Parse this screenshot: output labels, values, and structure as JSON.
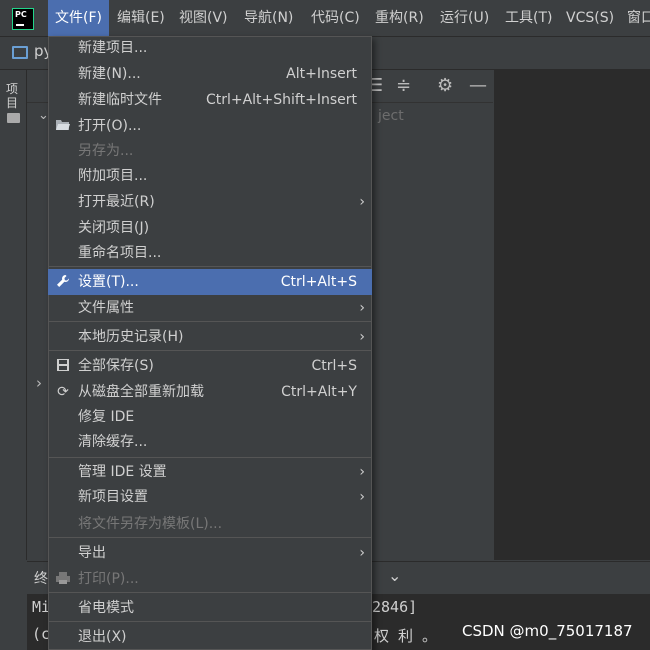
{
  "menubar": {
    "logo_text": "PC",
    "items": [
      "文件(F)",
      "编辑(E)",
      "视图(V)",
      "导航(N)",
      "代码(C)",
      "重构(R)",
      "运行(U)",
      "工具(T)",
      "VCS(S)",
      "窗口"
    ]
  },
  "project": {
    "name": "py",
    "side_tab_label": "项目",
    "hint_text": "ject"
  },
  "terminal": {
    "tab_label": "终",
    "line1_left": "Mi",
    "line1_right": "2846]",
    "line2_left": "(c",
    "line2_right": "权 利 。"
  },
  "watermark": "CSDN @m0_75017187",
  "file_menu": {
    "new_project": "新建项目...",
    "new": "新建(N)...",
    "new_shortcut": "Alt+Insert",
    "new_scratch": "新建临时文件",
    "new_scratch_shortcut": "Ctrl+Alt+Shift+Insert",
    "open": "打开(O)...",
    "save_as": "另存为...",
    "attach_project": "附加项目...",
    "open_recent": "打开最近(R)",
    "close_project": "关闭项目(J)",
    "rename_project": "重命名项目...",
    "settings": "设置(T)...",
    "settings_shortcut": "Ctrl+Alt+S",
    "file_properties": "文件属性",
    "local_history": "本地历史记录(H)",
    "save_all": "全部保存(S)",
    "save_all_shortcut": "Ctrl+S",
    "reload_all": "从磁盘全部重新加载",
    "reload_all_shortcut": "Ctrl+Alt+Y",
    "repair_ide": "修复 IDE",
    "invalidate_caches": "清除缓存...",
    "manage_ide_settings": "管理 IDE 设置",
    "new_project_settings": "新项目设置",
    "save_as_template": "将文件另存为模板(L)...",
    "export": "导出",
    "print": "打印(P)...",
    "power_save_mode": "省电模式",
    "exit": "退出(X)"
  },
  "colors": {
    "highlight": "#4b6eaf",
    "menu_bg": "#3c3f41",
    "editor_bg": "#2b2b2b"
  }
}
